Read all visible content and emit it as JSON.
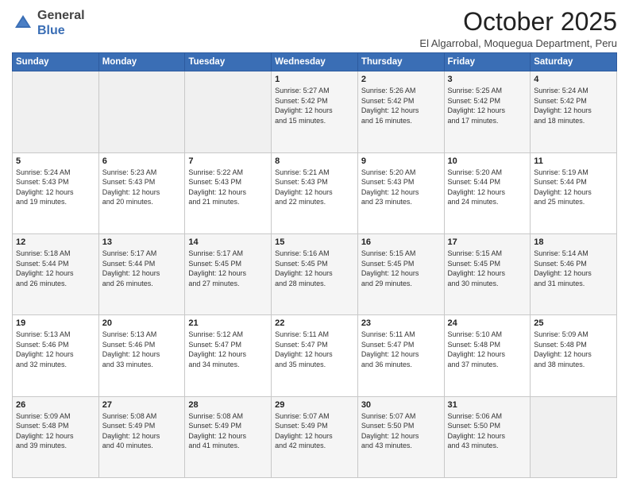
{
  "header": {
    "logo_general": "General",
    "logo_blue": "Blue",
    "title": "October 2025",
    "subtitle": "El Algarrobal, Moquegua Department, Peru"
  },
  "days_of_week": [
    "Sunday",
    "Monday",
    "Tuesday",
    "Wednesday",
    "Thursday",
    "Friday",
    "Saturday"
  ],
  "weeks": [
    [
      {
        "day": "",
        "info": ""
      },
      {
        "day": "",
        "info": ""
      },
      {
        "day": "",
        "info": ""
      },
      {
        "day": "1",
        "info": "Sunrise: 5:27 AM\nSunset: 5:42 PM\nDaylight: 12 hours\nand 15 minutes."
      },
      {
        "day": "2",
        "info": "Sunrise: 5:26 AM\nSunset: 5:42 PM\nDaylight: 12 hours\nand 16 minutes."
      },
      {
        "day": "3",
        "info": "Sunrise: 5:25 AM\nSunset: 5:42 PM\nDaylight: 12 hours\nand 17 minutes."
      },
      {
        "day": "4",
        "info": "Sunrise: 5:24 AM\nSunset: 5:42 PM\nDaylight: 12 hours\nand 18 minutes."
      }
    ],
    [
      {
        "day": "5",
        "info": "Sunrise: 5:24 AM\nSunset: 5:43 PM\nDaylight: 12 hours\nand 19 minutes."
      },
      {
        "day": "6",
        "info": "Sunrise: 5:23 AM\nSunset: 5:43 PM\nDaylight: 12 hours\nand 20 minutes."
      },
      {
        "day": "7",
        "info": "Sunrise: 5:22 AM\nSunset: 5:43 PM\nDaylight: 12 hours\nand 21 minutes."
      },
      {
        "day": "8",
        "info": "Sunrise: 5:21 AM\nSunset: 5:43 PM\nDaylight: 12 hours\nand 22 minutes."
      },
      {
        "day": "9",
        "info": "Sunrise: 5:20 AM\nSunset: 5:43 PM\nDaylight: 12 hours\nand 23 minutes."
      },
      {
        "day": "10",
        "info": "Sunrise: 5:20 AM\nSunset: 5:44 PM\nDaylight: 12 hours\nand 24 minutes."
      },
      {
        "day": "11",
        "info": "Sunrise: 5:19 AM\nSunset: 5:44 PM\nDaylight: 12 hours\nand 25 minutes."
      }
    ],
    [
      {
        "day": "12",
        "info": "Sunrise: 5:18 AM\nSunset: 5:44 PM\nDaylight: 12 hours\nand 26 minutes."
      },
      {
        "day": "13",
        "info": "Sunrise: 5:17 AM\nSunset: 5:44 PM\nDaylight: 12 hours\nand 26 minutes."
      },
      {
        "day": "14",
        "info": "Sunrise: 5:17 AM\nSunset: 5:45 PM\nDaylight: 12 hours\nand 27 minutes."
      },
      {
        "day": "15",
        "info": "Sunrise: 5:16 AM\nSunset: 5:45 PM\nDaylight: 12 hours\nand 28 minutes."
      },
      {
        "day": "16",
        "info": "Sunrise: 5:15 AM\nSunset: 5:45 PM\nDaylight: 12 hours\nand 29 minutes."
      },
      {
        "day": "17",
        "info": "Sunrise: 5:15 AM\nSunset: 5:45 PM\nDaylight: 12 hours\nand 30 minutes."
      },
      {
        "day": "18",
        "info": "Sunrise: 5:14 AM\nSunset: 5:46 PM\nDaylight: 12 hours\nand 31 minutes."
      }
    ],
    [
      {
        "day": "19",
        "info": "Sunrise: 5:13 AM\nSunset: 5:46 PM\nDaylight: 12 hours\nand 32 minutes."
      },
      {
        "day": "20",
        "info": "Sunrise: 5:13 AM\nSunset: 5:46 PM\nDaylight: 12 hours\nand 33 minutes."
      },
      {
        "day": "21",
        "info": "Sunrise: 5:12 AM\nSunset: 5:47 PM\nDaylight: 12 hours\nand 34 minutes."
      },
      {
        "day": "22",
        "info": "Sunrise: 5:11 AM\nSunset: 5:47 PM\nDaylight: 12 hours\nand 35 minutes."
      },
      {
        "day": "23",
        "info": "Sunrise: 5:11 AM\nSunset: 5:47 PM\nDaylight: 12 hours\nand 36 minutes."
      },
      {
        "day": "24",
        "info": "Sunrise: 5:10 AM\nSunset: 5:48 PM\nDaylight: 12 hours\nand 37 minutes."
      },
      {
        "day": "25",
        "info": "Sunrise: 5:09 AM\nSunset: 5:48 PM\nDaylight: 12 hours\nand 38 minutes."
      }
    ],
    [
      {
        "day": "26",
        "info": "Sunrise: 5:09 AM\nSunset: 5:48 PM\nDaylight: 12 hours\nand 39 minutes."
      },
      {
        "day": "27",
        "info": "Sunrise: 5:08 AM\nSunset: 5:49 PM\nDaylight: 12 hours\nand 40 minutes."
      },
      {
        "day": "28",
        "info": "Sunrise: 5:08 AM\nSunset: 5:49 PM\nDaylight: 12 hours\nand 41 minutes."
      },
      {
        "day": "29",
        "info": "Sunrise: 5:07 AM\nSunset: 5:49 PM\nDaylight: 12 hours\nand 42 minutes."
      },
      {
        "day": "30",
        "info": "Sunrise: 5:07 AM\nSunset: 5:50 PM\nDaylight: 12 hours\nand 43 minutes."
      },
      {
        "day": "31",
        "info": "Sunrise: 5:06 AM\nSunset: 5:50 PM\nDaylight: 12 hours\nand 43 minutes."
      },
      {
        "day": "",
        "info": ""
      }
    ]
  ]
}
